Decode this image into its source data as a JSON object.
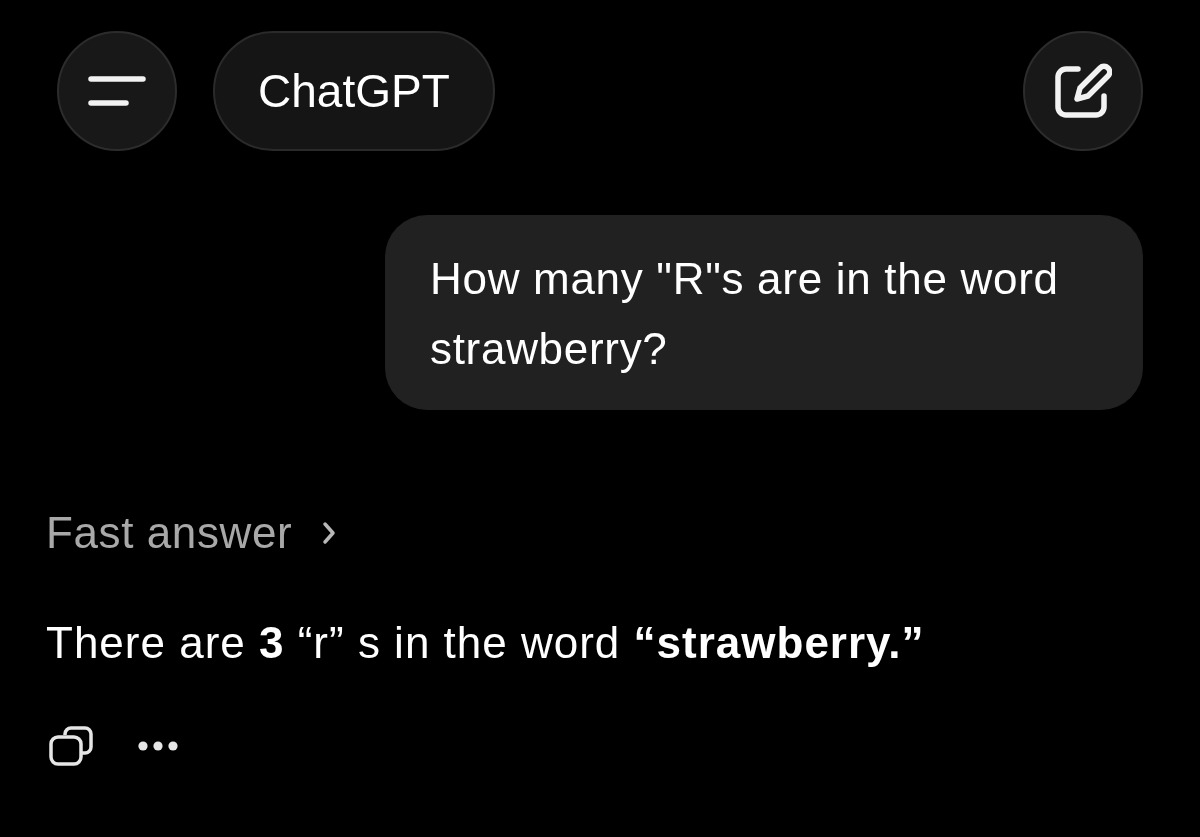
{
  "header": {
    "title": "ChatGPT"
  },
  "messages": [
    {
      "kind": "user",
      "text": "How many \"R\"s are in the word strawberry?"
    },
    {
      "kind": "assistant",
      "status": "Fast answer",
      "text": "There are **3** “r” s in the word **“strawberry.”**"
    }
  ]
}
